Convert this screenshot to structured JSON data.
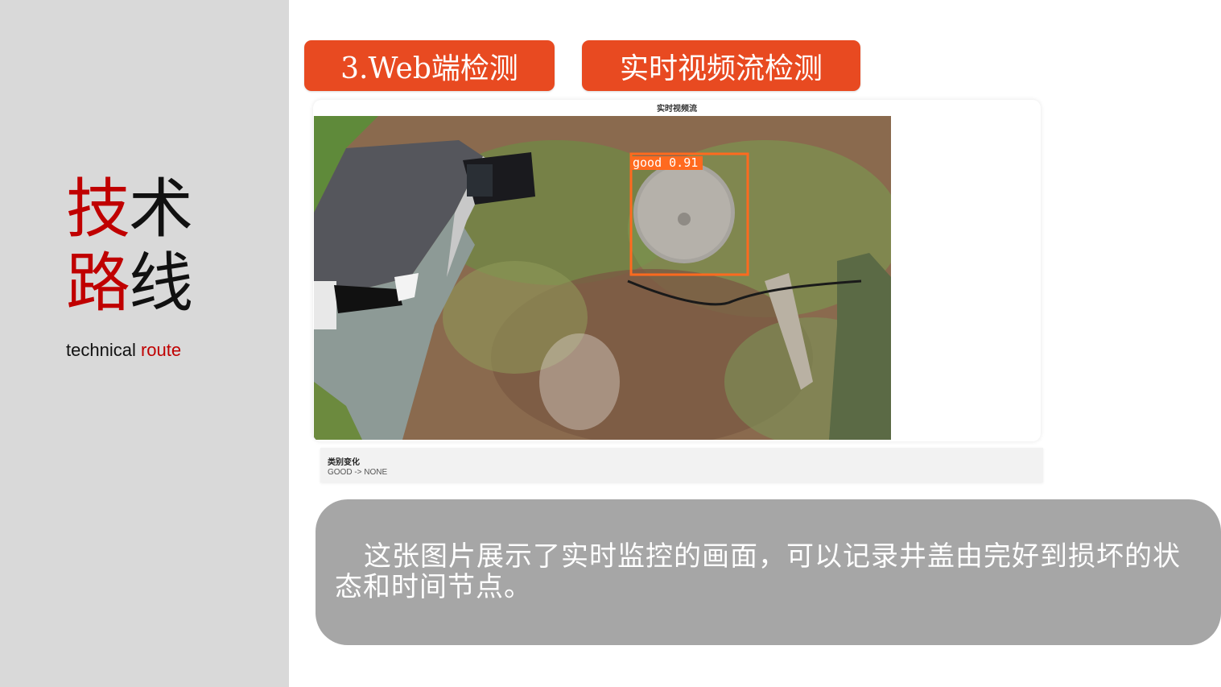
{
  "sidebar": {
    "title_line1": [
      "技",
      "术"
    ],
    "title_line2": [
      "路",
      "线"
    ],
    "subtitle_main": "technical",
    "subtitle_accent": "route"
  },
  "tags": {
    "web": "3.Web端检测",
    "stream": "实时视频流检测"
  },
  "panel": {
    "title": "实时视频流",
    "detection_label": "good 0.91"
  },
  "change": {
    "title": "类别变化",
    "value": "GOOD -> NONE"
  },
  "caption": {
    "text": "这张图片展示了实时监控的画面，可以记录井盖由完好到损坏的状态和时间节点。"
  },
  "colors": {
    "accent_red": "#c00000",
    "tag_orange": "#e84a21",
    "detection_box": "#ff6a1f",
    "sidebar_bg": "#d9d9d9",
    "caption_bg": "#a6a6a6"
  }
}
